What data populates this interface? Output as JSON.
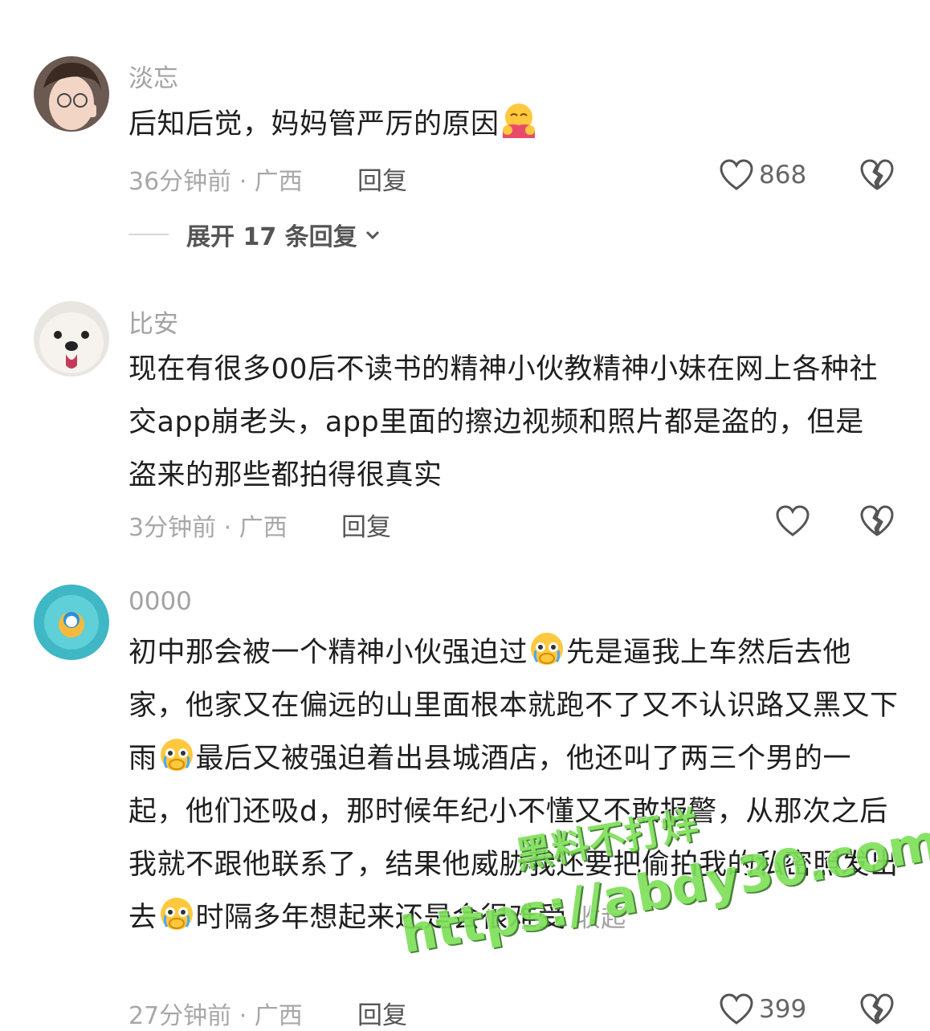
{
  "comments": [
    {
      "username": "淡忘",
      "text": "后知后觉，妈妈管严厉的原因",
      "meta": "36分钟前 · 广西",
      "reply_label": "回复",
      "likes": "868",
      "expand_label": "展开 17 条回复"
    },
    {
      "username": "比安",
      "text": "现在有很多00后不读书的精神小伙教精神小妹在网上各种社交app崩老头，app里面的擦边视频和照片都是盗的，但是盗来的那些都拍得很真实",
      "meta": "3分钟前 · 广西",
      "reply_label": "回复",
      "likes": ""
    },
    {
      "username": "0000",
      "text_part1": "初中那会被一个精神小伙强迫过",
      "text_part2": "先是逼我上车然后去他家，他家又在偏远的山里面根本就跑不了又不认识路又黑又下雨",
      "text_part3": "最后又被强迫着出县城酒店，他还叫了两三个男的一起，他们还吸d，那时候年纪小不懂又不敢报警，从那次之后我就不跟他联系了，结果他威胁我还要把偷拍我的私密照发出去",
      "text_part4": "时隔多年想起来还是会很难受",
      "collapse_label": "收起",
      "meta": "27分钟前 · 广西",
      "reply_label": "回复",
      "likes": "399"
    }
  ],
  "watermark": {
    "line1": "黑料不打烊",
    "line2": "https://abdy30.com"
  },
  "colors": {
    "muted": "#a3a3a3",
    "text": "#1f1f1f",
    "watermark": "#7ee05a"
  }
}
